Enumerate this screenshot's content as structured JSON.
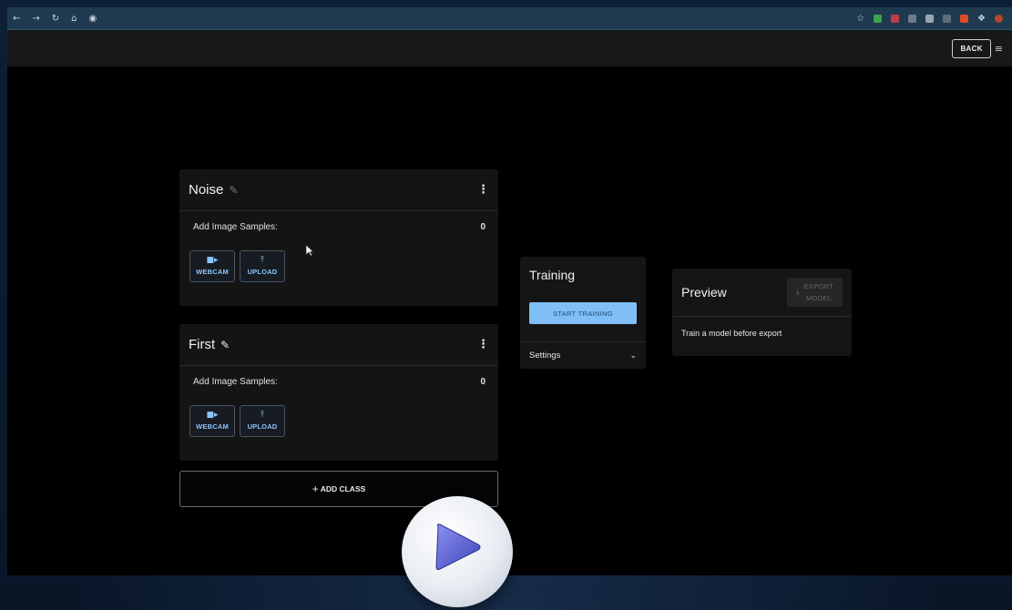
{
  "header": {
    "back_label": "BACK"
  },
  "classes": [
    {
      "name": "Noise",
      "samples_label": "Add Image Samples:",
      "samples_count": "0",
      "webcam_label": "WEBCAM",
      "upload_label": "UPLOAD"
    },
    {
      "name": "First",
      "samples_label": "Add Image Samples:",
      "samples_count": "0",
      "webcam_label": "WEBCAM",
      "upload_label": "UPLOAD"
    }
  ],
  "add_class_label": "ADD CLASS",
  "training": {
    "title": "Training",
    "button_label": "START TRAINING",
    "settings_label": "Settings"
  },
  "preview": {
    "title": "Preview",
    "export_label": "EXPORT\nMODEL",
    "note": "Train a model before export"
  },
  "colors": {
    "accent": "#7fbff5",
    "sample_button_text": "#8cc4ff",
    "browser_bar": "#1f3a4f"
  }
}
